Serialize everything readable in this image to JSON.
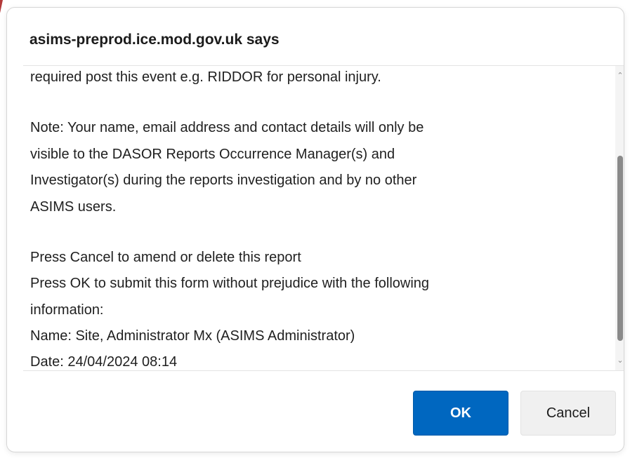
{
  "dialog": {
    "title": "asims-preprod.ice.mod.gov.uk says",
    "message_lines": [
      "required post this event e.g. RIDDOR for personal injury.",
      "",
      "Note: Your name, email address and contact details will only be",
      "visible to the DASOR Reports Occurrence Manager(s) and",
      "Investigator(s) during the reports investigation and by no other",
      "ASIMS users.",
      "",
      "Press Cancel to amend or delete this report",
      "Press OK to submit this form without prejudice with the following",
      "information:",
      "Name: Site, Administrator Mx (ASIMS Administrator)",
      "Date: 24/04/2024 08:14"
    ],
    "ok_label": "OK",
    "cancel_label": "Cancel",
    "accent_color": "#0067c0"
  },
  "scrollbar": {
    "up_icon": "chevron-up-icon",
    "down_icon": "chevron-down-icon"
  }
}
